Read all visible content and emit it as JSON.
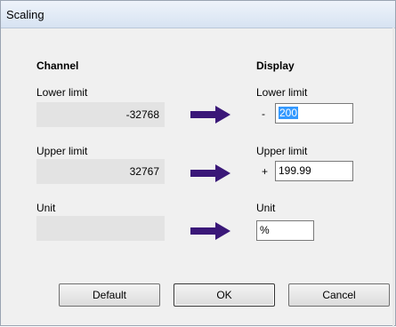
{
  "window": {
    "title": "Scaling"
  },
  "channel": {
    "header": "Channel",
    "lower_label": "Lower limit",
    "lower_value": "-32768",
    "upper_label": "Upper limit",
    "upper_value": "32767",
    "unit_label": "Unit",
    "unit_value": ""
  },
  "display": {
    "header": "Display",
    "lower_label": "Lower limit",
    "lower_sign": "-",
    "lower_value": "200",
    "upper_label": "Upper limit",
    "upper_sign": "+",
    "upper_value": "199.99",
    "unit_label": "Unit",
    "unit_value": "%"
  },
  "buttons": {
    "default": "Default",
    "ok": "OK",
    "cancel": "Cancel"
  },
  "colors": {
    "arrow": "#3a1778",
    "selection": "#3399ff"
  },
  "icons": {
    "arrow": "right-arrow-icon"
  }
}
